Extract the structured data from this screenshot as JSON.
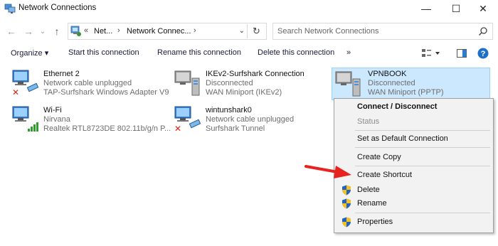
{
  "window": {
    "title": "Network Connections",
    "controls": {
      "minimize": "—",
      "maximize": "☐",
      "close": "✕"
    }
  },
  "address": {
    "prefix": "«",
    "crumb1": "Net...",
    "crumb2": "Network Connec...",
    "sep": "›",
    "dropdown": "⌄",
    "refresh": "↻"
  },
  "search": {
    "placeholder": "Search Network Connections"
  },
  "toolbar": {
    "organize": "Organize ▾",
    "start": "Start this connection",
    "rename": "Rename this connection",
    "delete": "Delete this connection",
    "more": "»"
  },
  "connections": [
    {
      "name": "Ethernet 2",
      "status": "Network cable unplugged",
      "device": "TAP-Surfshark Windows Adapter V9"
    },
    {
      "name": "IKEv2-Surfshark Connection",
      "status": "Disconnected",
      "device": "WAN Miniport (IKEv2)"
    },
    {
      "name": "VPNBOOK",
      "status": "Disconnected",
      "device": "WAN Miniport (PPTP)"
    },
    {
      "name": "Wi-Fi",
      "status": "Nirvana",
      "device": "Realtek RTL8723DE 802.11b/g/n P..."
    },
    {
      "name": "wintunshark0",
      "status": "Network cable unplugged",
      "device": "Surfshark Tunnel"
    }
  ],
  "context_menu": {
    "connect": "Connect / Disconnect",
    "status": "Status",
    "default": "Set as Default Connection",
    "copy": "Create Copy",
    "shortcut": "Create Shortcut",
    "delete": "Delete",
    "rename": "Rename",
    "properties": "Properties"
  },
  "colors": {
    "selection": "#cce8ff",
    "accent": "#0063b1",
    "arrow": "#e8231f"
  }
}
